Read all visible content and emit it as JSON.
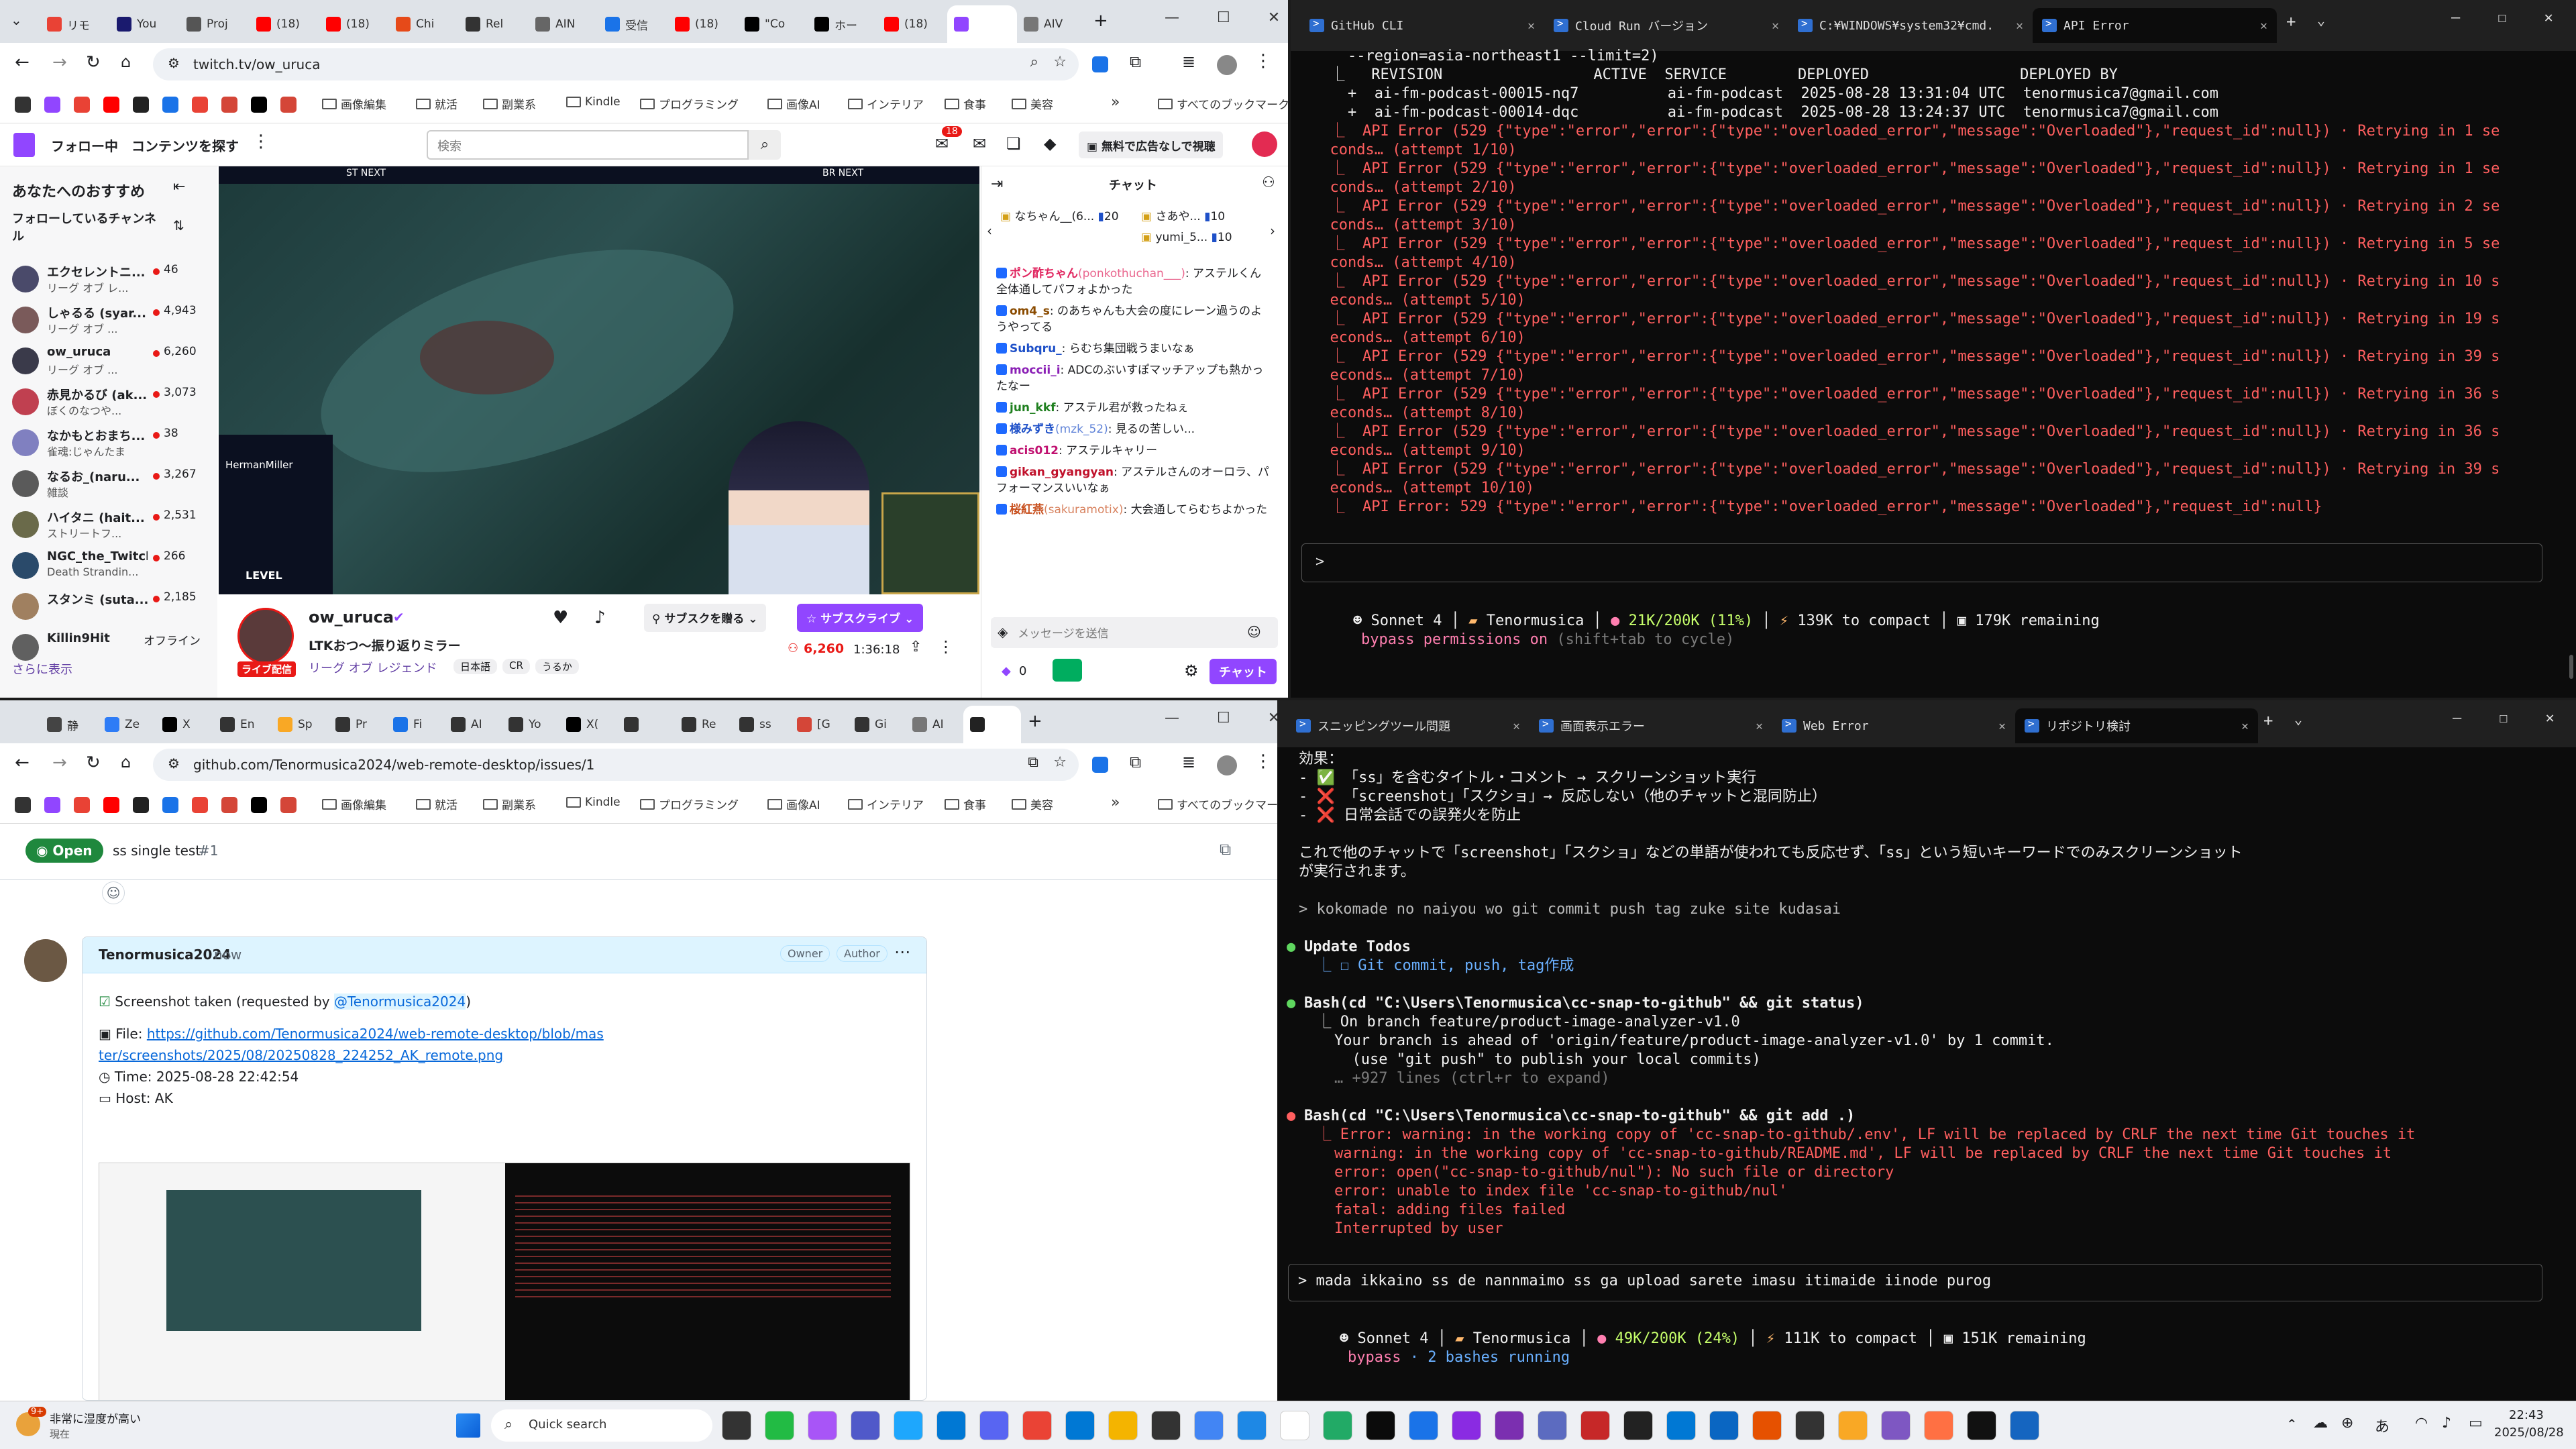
{
  "colors": {
    "twitch": "#9146ff",
    "github_open": "#1f883d",
    "term_error": "#ff5f5f",
    "live_red": "#e91916"
  },
  "browser1": {
    "tabs": [
      "リモ",
      "You",
      "Proj",
      "(18)",
      "(18)",
      "Chi",
      "Rel",
      "AIN",
      "受信",
      "(18)",
      "\"Co",
      "ホー",
      "(18)",
      "",
      "AIV"
    ],
    "url": "twitch.tv/ow_uruca",
    "bookmarks": [
      "画像編集",
      "就活",
      "副業系",
      "Kindle",
      "プログラミング",
      "画像AI",
      "インテリア",
      "食事",
      "美容"
    ],
    "all_bookmarks": "すべてのブックマーク",
    "twitch": {
      "nav_following": "フォロー中",
      "nav_browse": "コンテンツを探す",
      "search_placeholder": "検索",
      "notif_count": "18",
      "ad_free": "無料で広告なしで視聴",
      "sidebar_title": "あなたへのおすすめ",
      "following_channels": "フォローしているチャンネル",
      "channels": [
        {
          "name": "エクセレントニ...",
          "game": "リーグ オブ レ...",
          "viewers": "46"
        },
        {
          "name": "しゃるる (syar...",
          "game": "リーグ オブ ...",
          "viewers": "4,943"
        },
        {
          "name": "ow_uruca",
          "game": "リーグ オブ ...",
          "viewers": "6,260"
        },
        {
          "name": "赤見かるび (ak...",
          "game": "ぼくのなつや...",
          "viewers": "3,073"
        },
        {
          "name": "なかもとおまち...",
          "game": "雀魂:じゃんたま",
          "viewers": "38"
        },
        {
          "name": "なるお_(naru...",
          "game": "雑談",
          "viewers": "3,267"
        },
        {
          "name": "ハイタニ (hait...",
          "game": "ストリートフ...",
          "viewers": "2,531"
        },
        {
          "name": "NGC_the_Twitch",
          "game": "Death Strandin...",
          "viewers": "266"
        },
        {
          "name": "スタンミ (suta...",
          "game": "",
          "viewers": "2,185"
        },
        {
          "name": "Killin9Hit",
          "game": "",
          "viewers": "オフライン"
        }
      ],
      "show_more": "さらに表示",
      "streamer": "ow_uruca",
      "stream_title": "LTKおつ〜振り返りミラー",
      "category": "リーグ オブ レジェンド",
      "tags": [
        "日本語",
        "CR",
        "うるか"
      ],
      "live": "ライブ配信",
      "viewers": "6,260",
      "uptime": "1:36:18",
      "gift_sub": "サブスクを贈る",
      "subscribe": "サブスクライブ",
      "chat_title": "チャット",
      "pinned": [
        {
          "name": "なちゃん__(6...",
          "count": "20"
        },
        {
          "name": "さあや...",
          "count": "10"
        },
        {
          "name": "yumi_5...",
          "count": "10"
        }
      ],
      "messages": [
        {
          "user": "ポン酢ちゃん",
          "handle": "(ponkothuchan___)",
          "text": ": アステルくん全体通してパフォよかった",
          "color": "#e0245e"
        },
        {
          "user": "om4_s",
          "handle": "",
          "text": ": のあちゃんも大会の度にレーン過うのようやってる",
          "color": "#8a4b00"
        },
        {
          "user": "Subqru_",
          "handle": "",
          "text": ": らむち集団戦うまいなぁ",
          "color": "#1e50c8"
        },
        {
          "user": "moccii_i",
          "handle": "",
          "text": ": ADCのぶいすぽマッチアップも熱かったなー",
          "color": "#8a1fb5"
        },
        {
          "user": "jun_kkf",
          "handle": "",
          "text": ": アステル君が救ったねぇ",
          "color": "#208020"
        },
        {
          "user": "様みずき",
          "handle": "(mzk_52)",
          "text": ": 見るの苦しい...",
          "color": "#1e50c8"
        },
        {
          "user": "acis012",
          "handle": "",
          "text": ": アステルキャリー",
          "color": "#c01070"
        },
        {
          "user": "gikan_gyangyan",
          "handle": "",
          "text": ": アステルさんのオーロラ、パフォーマンスいいなぁ",
          "color": "#c0102a"
        },
        {
          "user": "桜紅燕",
          "handle": "(sakuramotix)",
          "text": ": 大会通してらむちよかった",
          "color": "#c8501e"
        }
      ],
      "chat_placeholder": "メッセージを送信",
      "points": "0",
      "chat_button": "チャット",
      "overlay": {
        "st_next": "ST NEXT",
        "br_next": "BR NEXT",
        "caster": "HermanMiller",
        "brand": "LEVEL"
      }
    }
  },
  "browser2": {
    "url": "github.com/Tenormusica2024/web-remote-desktop/issues/1",
    "tabs": [
      "静",
      "Ze",
      "X",
      "En",
      "Sp",
      "Pr",
      "Fi",
      "AI",
      "Yo",
      "X(",
      "",
      "Re",
      "ss",
      "[G",
      "Gi",
      "AI",
      ""
    ],
    "github": {
      "status": "Open",
      "title": "ss single test",
      "number": "#1",
      "author": "Tenormusica2024",
      "time": "now",
      "badges": [
        "Owner",
        "Author"
      ],
      "check_text": "Screenshot taken",
      "requested_prefix": " (requested by ",
      "mention": "@Tenormusica2024",
      "requested_suffix": ")",
      "file_label": "File: ",
      "file_link": "https://github.com/Tenormusica2024/web-remote-desktop/blob/master/screenshots/2025/08/20250828_224252_AK_remote.png",
      "time_label": "Time: ",
      "time_value": "2025-08-28 22:42:54",
      "host_label": "Host: ",
      "host_value": "AK"
    }
  },
  "term1": {
    "tabs": [
      "GitHub CLI",
      "Cloud Run バージョン",
      "C:¥WINDOWS¥system32¥cmd.",
      "API Error"
    ],
    "header_lines": [
      "    --region=asia-northeast1 --limit=2)",
      "  ⎿   REVISION                 ACTIVE  SERVICE        DEPLOYED                 DEPLOYED BY",
      "    +  ai-fm-podcast-00015-nq7          ai-fm-podcast  2025-08-28 13:31:04 UTC  tenormusica7@gmail.com",
      "    +  ai-fm-podcast-00014-dqc          ai-fm-podcast  2025-08-28 13:24:37 UTC  tenormusica7@gmail.com"
    ],
    "errors": [
      [
        "  ⎿  API Error (529 {\"type\":\"error\",\"error\":{\"type\":\"overloaded_error\",\"message\":\"Overloaded\"},\"request_id\":null}) · Retrying in 1 se",
        "  conds… (attempt 1/10)"
      ],
      [
        "  ⎿  API Error (529 {\"type\":\"error\",\"error\":{\"type\":\"overloaded_error\",\"message\":\"Overloaded\"},\"request_id\":null}) · Retrying in 1 se",
        "  conds… (attempt 2/10)"
      ],
      [
        "  ⎿  API Error (529 {\"type\":\"error\",\"error\":{\"type\":\"overloaded_error\",\"message\":\"Overloaded\"},\"request_id\":null}) · Retrying in 2 se",
        "  conds… (attempt 3/10)"
      ],
      [
        "  ⎿  API Error (529 {\"type\":\"error\",\"error\":{\"type\":\"overloaded_error\",\"message\":\"Overloaded\"},\"request_id\":null}) · Retrying in 5 se",
        "  conds… (attempt 4/10)"
      ],
      [
        "  ⎿  API Error (529 {\"type\":\"error\",\"error\":{\"type\":\"overloaded_error\",\"message\":\"Overloaded\"},\"request_id\":null}) · Retrying in 10 s",
        "  econds… (attempt 5/10)"
      ],
      [
        "  ⎿  API Error (529 {\"type\":\"error\",\"error\":{\"type\":\"overloaded_error\",\"message\":\"Overloaded\"},\"request_id\":null}) · Retrying in 19 s",
        "  econds… (attempt 6/10)"
      ],
      [
        "  ⎿  API Error (529 {\"type\":\"error\",\"error\":{\"type\":\"overloaded_error\",\"message\":\"Overloaded\"},\"request_id\":null}) · Retrying in 39 s",
        "  econds… (attempt 7/10)"
      ],
      [
        "  ⎿  API Error (529 {\"type\":\"error\",\"error\":{\"type\":\"overloaded_error\",\"message\":\"Overloaded\"},\"request_id\":null}) · Retrying in 36 s",
        "  econds… (attempt 8/10)"
      ],
      [
        "  ⎿  API Error (529 {\"type\":\"error\",\"error\":{\"type\":\"overloaded_error\",\"message\":\"Overloaded\"},\"request_id\":null}) · Retrying in 36 s",
        "  econds… (attempt 9/10)"
      ],
      [
        "  ⎿  API Error (529 {\"type\":\"error\",\"error\":{\"type\":\"overloaded_error\",\"message\":\"Overloaded\"},\"request_id\":null}) · Retrying in 39 s",
        "  econds… (attempt 10/10)"
      ]
    ],
    "final_error": "  ⎿  API Error: 529 {\"type\":\"error\",\"error\":{\"type\":\"overloaded_error\",\"message\":\"Overloaded\"},\"request_id\":null}",
    "prompt": ">",
    "status": {
      "model": "Sonnet 4",
      "project": "Tenormusica",
      "context": "21K/200K (11%)",
      "compact": "139K to compact",
      "remaining": "179K remaining"
    },
    "bypass_label": "bypass permissions on",
    "bypass_hint": "(shift+tab to cycle)"
  },
  "term2": {
    "tabs": [
      "スニッピングツール問題",
      "画面表示エラー",
      "Web Error",
      "リポジトリ検討"
    ],
    "effect_title": "効果：",
    "effects": [
      "- ✅ 「ss」を含むタイトル・コメント → スクリーンショット実行",
      "- ❌ 「screenshot」「スクショ」→ 反応しない（他のチャットと混同防止）",
      "- ❌ 日常会話での誤発火を防止"
    ],
    "summary_1": "これで他のチャットで「screenshot」「スクショ」などの単語が使われても反応せず、「ss」という短いキーワードでのみスクリーンショット",
    "summary_2": "が実行されます。",
    "user_cmd": "> kokomade no naiyou wo git commit push tag zuke site kudasai",
    "todos_title": "Update Todos",
    "todo_item": "  ⎿ ☐ Git commit, push, tag作成",
    "bash1": "Bash(cd \"C:\\Users\\Tenormusica\\cc-snap-to-github\" && git status)",
    "bash1_out": [
      "  ⎿ On branch feature/product-image-analyzer-v1.0",
      "    Your branch is ahead of 'origin/feature/product-image-analyzer-v1.0' by 1 commit.",
      "      (use \"git push\" to publish your local commits)",
      "    … +927 lines (ctrl+r to expand)"
    ],
    "bash2": "Bash(cd \"C:\\Users\\Tenormusica\\cc-snap-to-github\" && git add .)",
    "bash2_out": [
      "  ⎿ Error: warning: in the working copy of 'cc-snap-to-github/.env', LF will be replaced by CRLF the next time Git touches it",
      "    warning: in the working copy of 'cc-snap-to-github/README.md', LF will be replaced by CRLF the next time Git touches it",
      "    error: open(\"cc-snap-to-github/nul\"): No such file or directory",
      "    error: unable to index file 'cc-snap-to-github/nul'",
      "    fatal: adding files failed",
      "    Interrupted by user"
    ],
    "input": "> mada ikkaino ss de nannmaimo ss ga upload sarete imasu itimaide iinode purog",
    "status": {
      "model": "Sonnet 4",
      "project": "Tenormusica",
      "context": "49K/200K (24%)",
      "compact": "111K to compact",
      "remaining": "151K remaining"
    },
    "bypass": "bypass",
    "bashes": "· 2 bashes running"
  },
  "taskbar": {
    "weather_badge": "9+",
    "weather_line1": "非常に湿度が高い",
    "weather_line2": "現在",
    "search": "Quick search",
    "time": "22:43",
    "date": "2025/08/28",
    "ime": "あ"
  }
}
